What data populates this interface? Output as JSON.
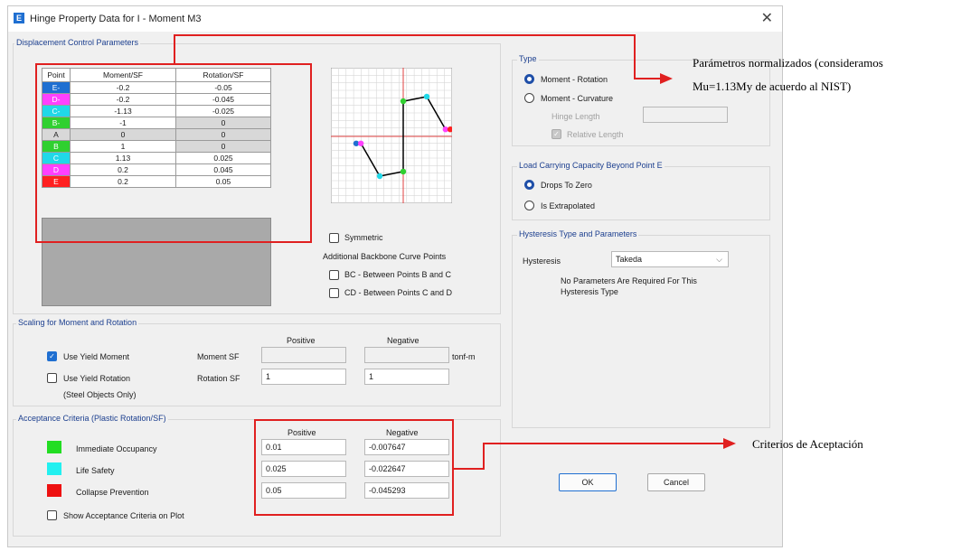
{
  "window": {
    "title": "Hinge Property Data for I - Moment M3",
    "app_icon": "E"
  },
  "displacement": {
    "group_label": "Displacement Control Parameters",
    "headers": [
      "Point",
      "Moment/SF",
      "Rotation/SF"
    ],
    "rows": [
      {
        "point": "E-",
        "moment": "-0.2",
        "rotation": "-0.05",
        "color": "#1f6fd1"
      },
      {
        "point": "D-",
        "moment": "-0.2",
        "rotation": "-0.045",
        "color": "#ff40ff"
      },
      {
        "point": "C-",
        "moment": "-1.13",
        "rotation": "-0.025",
        "color": "#20d8e8"
      },
      {
        "point": "B-",
        "moment": "-1",
        "rotation": "0",
        "color": "#30d030"
      },
      {
        "point": "A",
        "moment": "0",
        "rotation": "0",
        "color": "#d8d8d8"
      },
      {
        "point": "B",
        "moment": "1",
        "rotation": "0",
        "color": "#30d030"
      },
      {
        "point": "C",
        "moment": "1.13",
        "rotation": "0.025",
        "color": "#20d8e8"
      },
      {
        "point": "D",
        "moment": "0.2",
        "rotation": "0.045",
        "color": "#ff40ff"
      },
      {
        "point": "E",
        "moment": "0.2",
        "rotation": "0.05",
        "color": "#ff2020"
      }
    ],
    "symmetric_label": "Symmetric",
    "additional_label": "Additional Backbone Curve Points",
    "bc_label": "BC - Between Points B and C",
    "cd_label": "CD - Between Points C and D"
  },
  "type": {
    "group_label": "Type",
    "moment_rotation": "Moment - Rotation",
    "moment_curvature": "Moment - Curvature",
    "hinge_length": "Hinge Length",
    "relative_length": "Relative Length"
  },
  "load_capacity": {
    "group_label": "Load Carrying Capacity Beyond Point E",
    "drops_to_zero": "Drops To Zero",
    "is_extrapolated": "Is Extrapolated"
  },
  "hysteresis": {
    "group_label": "Hysteresis Type and Parameters",
    "label": "Hysteresis",
    "value": "Takeda",
    "note_line1": "No Parameters Are Required For This",
    "note_line2": "Hysteresis Type"
  },
  "scaling": {
    "group_label": "Scaling for Moment and Rotation",
    "positive": "Positive",
    "negative": "Negative",
    "use_yield_moment": "Use Yield Moment",
    "use_yield_rotation": "Use Yield Rotation",
    "steel_only": "(Steel Objects Only)",
    "moment_sf": "Moment SF",
    "rotation_sf": "Rotation SF",
    "unit": "tonf-m",
    "moment_pos": "",
    "moment_neg": "",
    "rotation_pos": "1",
    "rotation_neg": "1"
  },
  "acceptance": {
    "group_label": "Acceptance Criteria (Plastic Rotation/SF)",
    "positive": "Positive",
    "negative": "Negative",
    "rows": [
      {
        "label": "Immediate Occupancy",
        "pos": "0.01",
        "neg": "-0.007647",
        "color": "#22dd22"
      },
      {
        "label": "Life Safety",
        "pos": "0.025",
        "neg": "-0.022647",
        "color": "#22f0f0"
      },
      {
        "label": "Collapse Prevention",
        "pos": "0.05",
        "neg": "-0.045293",
        "color": "#ee1111"
      }
    ],
    "show_on_plot": "Show Acceptance Criteria on Plot"
  },
  "buttons": {
    "ok": "OK",
    "cancel": "Cancel"
  },
  "annotations": {
    "params_line1": "Parámetros normalizados (consideramos",
    "params_line2": "Mu=1.13My de acuerdo al NIST)",
    "criteria": "Criterios de Aceptación"
  },
  "icons": {
    "close": "close-icon",
    "dropdown": "chevron-down-icon",
    "check": "check-icon"
  }
}
